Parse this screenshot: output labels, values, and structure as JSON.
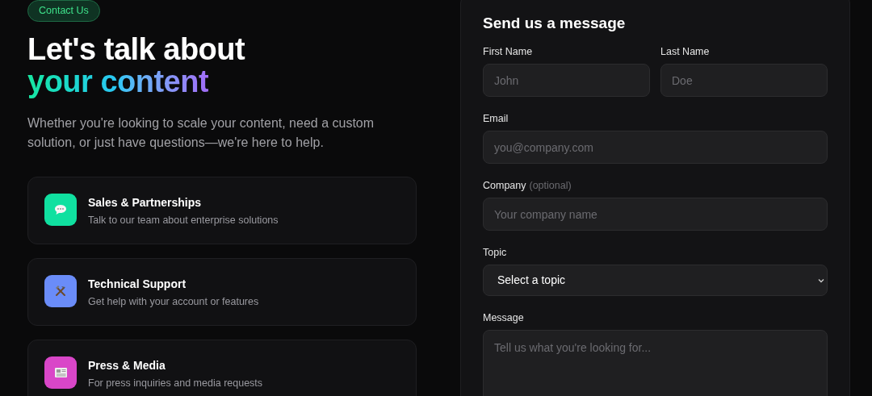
{
  "badge": "Contact Us",
  "headline": {
    "line1": "Let's talk about",
    "line2": "your content"
  },
  "intro": "Whether you're looking to scale your content, need a custom solution, or just have questions—we're here to help.",
  "cards": [
    {
      "kind": "chat",
      "color": "#10e0a0",
      "title": "Sales & Partnerships",
      "text": "Talk to our team about enterprise solutions"
    },
    {
      "kind": "tools",
      "color": "#6a8cf8",
      "title": "Technical Support",
      "text": "Get help with your account or features"
    },
    {
      "kind": "newspaper",
      "color": "#d946c8",
      "title": "Press & Media",
      "text": "For press inquiries and media requests"
    }
  ],
  "form": {
    "title": "Send us a message",
    "rows": [
      [
        {
          "kind": "input",
          "label": "First Name",
          "placeholder": "John"
        },
        {
          "kind": "input",
          "label": "Last Name",
          "placeholder": "Doe"
        }
      ],
      [
        {
          "kind": "input",
          "label": "Email",
          "placeholder": "you@company.com"
        }
      ],
      [
        {
          "kind": "input",
          "label": "Company",
          "hint": "(optional)",
          "placeholder": "Your company name"
        }
      ],
      [
        {
          "kind": "select",
          "label": "Topic",
          "value": "Select a topic"
        }
      ],
      [
        {
          "kind": "textarea",
          "label": "Message",
          "placeholder": "Tell us what you're looking for..."
        }
      ]
    ]
  }
}
